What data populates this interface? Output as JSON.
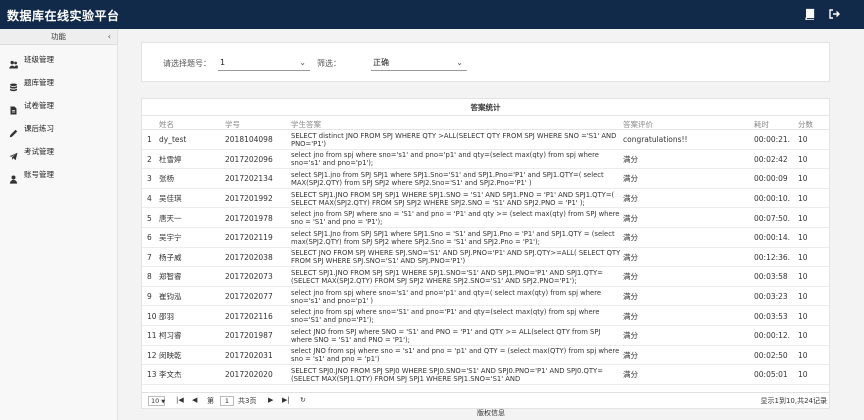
{
  "app": {
    "title": "数据库在线实验平台"
  },
  "topbar": {
    "icons": [
      "book-icon",
      "logout-icon"
    ]
  },
  "sidebar": {
    "header": "功能",
    "items": [
      {
        "label": "班级管理",
        "icon": "users-icon"
      },
      {
        "label": "题库管理",
        "icon": "database-icon"
      },
      {
        "label": "试卷管理",
        "icon": "file-icon"
      },
      {
        "label": "课后练习",
        "icon": "pencil-icon"
      },
      {
        "label": "考试管理",
        "icon": "send-icon"
      },
      {
        "label": "账号管理",
        "icon": "user-icon"
      }
    ]
  },
  "filter": {
    "question_label": "请选择题号：",
    "question_value": "1",
    "filter_label": "筛选：",
    "filter_value": "正确"
  },
  "table": {
    "title": "答案统计",
    "columns": [
      "姓名",
      "学号",
      "学生答案",
      "答案评价",
      "耗时",
      "分数"
    ],
    "rows": [
      {
        "idx": "1",
        "name": "dy_test",
        "sid": "2018104098",
        "answer": "SELECT distinct JNO FROM SPJ WHERE QTY >ALL(SELECT QTY FROM SPJ WHERE SNO ='S1' AND PNO='P1')",
        "eval": "congratulations!!",
        "time": "00:00:21.",
        "score": "10"
      },
      {
        "idx": "2",
        "name": "杜雪婷",
        "sid": "2017202096",
        "answer": "select jno from spj where sno='s1' and pno='p1' and qty=(select max(qty) from spj where sno='s1' and pno='p1');",
        "eval": "满分",
        "time": "00:02:42",
        "score": "10"
      },
      {
        "idx": "3",
        "name": "张杨",
        "sid": "2017202134",
        "answer": "select SPJ1.jno from SPJ SPJ1 where SPJ1.Sno='S1' and SPJ1.Pno='P1' and SPJ1.QTY=( select MAX(SPJ2.QTY) from SPJ SPJ2 where SPJ2.Sno='S1' and SPJ2.Pno='P1' )",
        "eval": "满分",
        "time": "00:00:09",
        "score": "10"
      },
      {
        "idx": "4",
        "name": "吴佳琪",
        "sid": "2017201992",
        "answer": "SELECT SPJ1.JNO FROM SPJ SPJ1 WHERE SPJ1.SNO = 'S1' AND SPJ1.PNO = 'P1' AND SPJ1.QTY=( SELECT MAX(SPJ2.QTY) FROM SPJ SPJ2 WHERE SPJ2.SNO = 'S1' AND SPJ2.PNO = 'P1' );",
        "eval": "满分",
        "time": "00:00:10.",
        "score": "10"
      },
      {
        "idx": "5",
        "name": "唐天一",
        "sid": "2017201978",
        "answer": "select jno from SPJ where sno = 'S1' and pno = 'P1' and qty >= (select max(qty) from SPJ where sno = 'S1' and pno = 'P1');",
        "eval": "满分",
        "time": "00:07:50.",
        "score": "10"
      },
      {
        "idx": "6",
        "name": "吴宇宁",
        "sid": "2017202119",
        "answer": "select SPJ1.Jno from SPJ SPJ1 where SPJ1.Sno = 'S1' and SPJ1.Pno = 'P1' and SPJ1.QTY = (select max(SPJ2.QTY) from SPJ SPJ2 where SPJ2.Sno = 'S1' and SPJ2.Pno = 'P1');",
        "eval": "满分",
        "time": "00:00:14.",
        "score": "10"
      },
      {
        "idx": "7",
        "name": "杨子威",
        "sid": "2017202038",
        "answer": "SELECT JNO FROM SPJ WHERE SPJ.SNO='S1' AND SPJ.PNO='P1' AND SPJ.QTY>=ALL( SELECT QTY FROM SPJ WHERE SPJ.SNO='S1' AND SPJ.PNO='P1')",
        "eval": "满分",
        "time": "00:12:36.",
        "score": "10"
      },
      {
        "idx": "8",
        "name": "郑智睿",
        "sid": "2017202073",
        "answer": "SELECT SPJ1.JNO FROM SPJ SPJ1 WHERE SPJ1.SNO='S1' AND SPJ1.PNO='P1' AND SPJ1.QTY= (SELECT MAX(SPJ2.QTY) FROM SPJ SPJ2 WHERE SPJ2.SNO='S1' AND SPJ2.PNO='P1');",
        "eval": "满分",
        "time": "00:03:58",
        "score": "10"
      },
      {
        "idx": "9",
        "name": "崔钧泓",
        "sid": "2017202077",
        "answer": "select jno from spj where sno='s1' and pno='p1' and qty=( select max(qty) from spj where sno='s1' and pno='p1' )",
        "eval": "满分",
        "time": "00:03:23",
        "score": "10"
      },
      {
        "idx": "10",
        "name": "邵羽",
        "sid": "2017202116",
        "answer": "select jno from spj where sno='S1' and pno='P1' and qty=(select max(qty) from spj where sno='S1' and pno='P1');",
        "eval": "满分",
        "time": "00:03:53",
        "score": "10"
      },
      {
        "idx": "11",
        "name": "柯习睿",
        "sid": "2017201987",
        "answer": "select JNO from SPJ where SNO = 'S1' and PNO = 'P1' and QTY >= ALL(select QTY from SPJ where SNO = 'S1' and PNO = 'P1');",
        "eval": "满分",
        "time": "00:00:12.",
        "score": "10"
      },
      {
        "idx": "12",
        "name": "闵映乾",
        "sid": "2017202031",
        "answer": "select JNO from spj where sno = 's1' and pno = 'p1' and QTY = (select max(QTY) from spj where sno = 's1' and pno = 'p1')",
        "eval": "满分",
        "time": "00:02:50",
        "score": "10"
      },
      {
        "idx": "13",
        "name": "李文杰",
        "sid": "2017202020",
        "answer": "SELECT SPJ0.JNO FROM SPJ SPJ0 WHERE SPJ0.SNO='S1' AND SPJ0.PNO='P1' AND SPJ0.QTY=(SELECT MAX(SPJ1.QTY) FROM SPJ SPJ1 WHERE SPJ1.SNO='S1' AND",
        "eval": "满分",
        "time": "00:05:01",
        "score": "10"
      }
    ]
  },
  "pager": {
    "page_size": "10",
    "page_prefix": "第",
    "page_value": "1",
    "page_total": "共3页",
    "summary": "显示1到10,共24记录"
  },
  "footer": {
    "text": "版权信息"
  }
}
